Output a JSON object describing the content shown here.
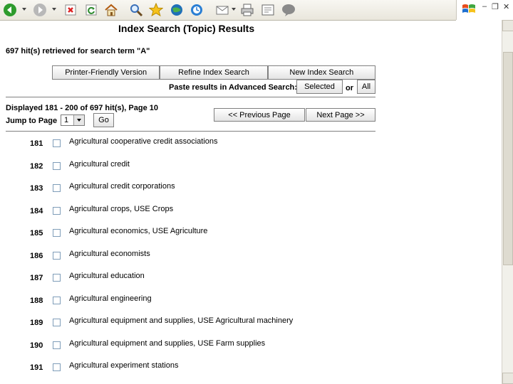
{
  "toolbar": {
    "icons": [
      "back-icon",
      "forward-icon",
      "stop-icon",
      "refresh-icon",
      "home-icon",
      "search-icon",
      "favorites-icon",
      "media-icon",
      "history-icon",
      "mail-icon",
      "print-icon",
      "edit-icon",
      "discuss-icon"
    ]
  },
  "window": {
    "minimize": "–",
    "restore": "❐",
    "close": "✕"
  },
  "page": {
    "title": "Index Search (Topic) Results",
    "hits_text": "697 hit(s) retrieved for search term \"A\"",
    "buttons": {
      "printer_friendly": "Printer-Friendly Version",
      "refine": "Refine Index Search",
      "new_search": "New Index Search"
    },
    "paste_label": "Paste results in Advanced Search:",
    "selected": "Selected",
    "or": "or",
    "all": "All",
    "displayed": "Displayed 181 - 200 of 697 hit(s), Page 10",
    "jump_label": "Jump to Page",
    "page_select_value": "1",
    "go": "Go",
    "prev": "<< Previous Page",
    "next": "Next Page >>"
  },
  "results": [
    {
      "num": "181",
      "label": "Agricultural cooperative credit associations"
    },
    {
      "num": "182",
      "label": "Agricultural credit"
    },
    {
      "num": "183",
      "label": "Agricultural credit corporations"
    },
    {
      "num": "184",
      "label": "Agricultural crops, USE Crops"
    },
    {
      "num": "185",
      "label": "Agricultural economics, USE Agriculture"
    },
    {
      "num": "186",
      "label": "Agricultural economists"
    },
    {
      "num": "187",
      "label": "Agricultural education"
    },
    {
      "num": "188",
      "label": "Agricultural engineering"
    },
    {
      "num": "189",
      "label": "Agricultural equipment and supplies, USE Agricultural machinery"
    },
    {
      "num": "190",
      "label": "Agricultural equipment and supplies, USE Farm supplies"
    },
    {
      "num": "191",
      "label": "Agricultural experiment stations"
    }
  ]
}
